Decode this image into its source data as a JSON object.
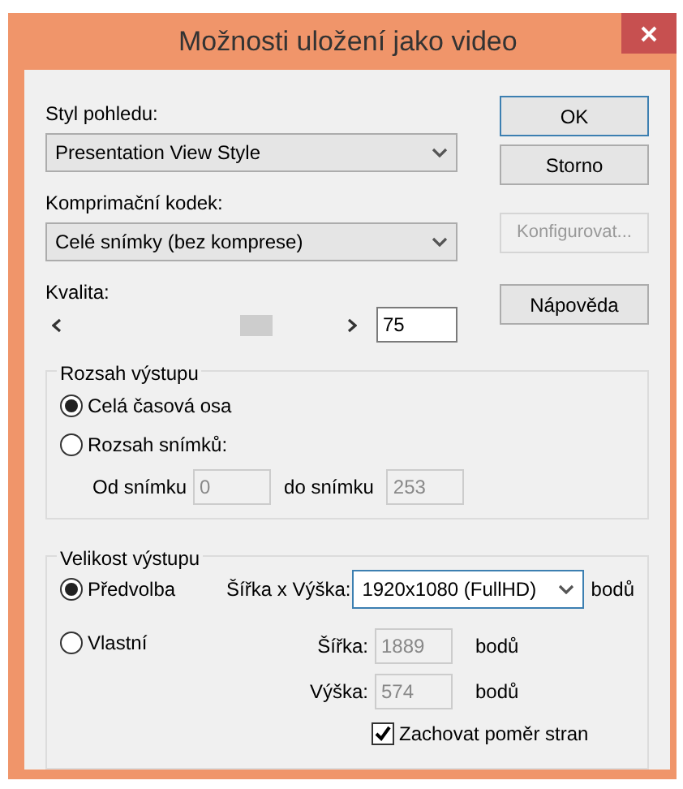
{
  "window": {
    "title": "Možnosti uložení jako video"
  },
  "view_style": {
    "label": "Styl pohledu:",
    "value": "Presentation View Style"
  },
  "codec": {
    "label": "Komprimační kodek:",
    "value": "Celé snímky (bez komprese)"
  },
  "quality": {
    "label": "Kvalita:",
    "level": 0.72,
    "value": "75"
  },
  "buttons": [
    {
      "label": "OK",
      "default": true,
      "disabled": false
    },
    {
      "label": "Storno",
      "default": false,
      "disabled": false
    },
    {
      "label": "Konfigurovat...",
      "default": false,
      "disabled": true
    },
    {
      "label": "Nápověda",
      "default": false,
      "disabled": false
    }
  ],
  "output_range": {
    "title": "Rozsah výstupu",
    "options": [
      {
        "label": "Celá časová osa",
        "selected": true
      },
      {
        "label": "Rozsah snímků:",
        "selected": false
      }
    ],
    "from_label": "Od snímku",
    "from_value": "0",
    "to_label": "do snímku",
    "to_value": "253"
  },
  "output_size": {
    "title": "Velikost výstupu",
    "options": [
      {
        "label": "Předvolba",
        "selected": true
      },
      {
        "label": "Vlastní",
        "selected": false
      }
    ],
    "preset_label": "Šířka x Výška:",
    "preset_value": "1920x1080 (FullHD)",
    "preset_unit": "bodů",
    "width_label": "Šířka:",
    "width_value": "1889",
    "width_unit": "bodů",
    "height_label": "Výška:",
    "height_value": "574",
    "height_unit": "bodů",
    "keep_ratio": {
      "label": "Zachovat poměr stran",
      "checked": true
    }
  }
}
